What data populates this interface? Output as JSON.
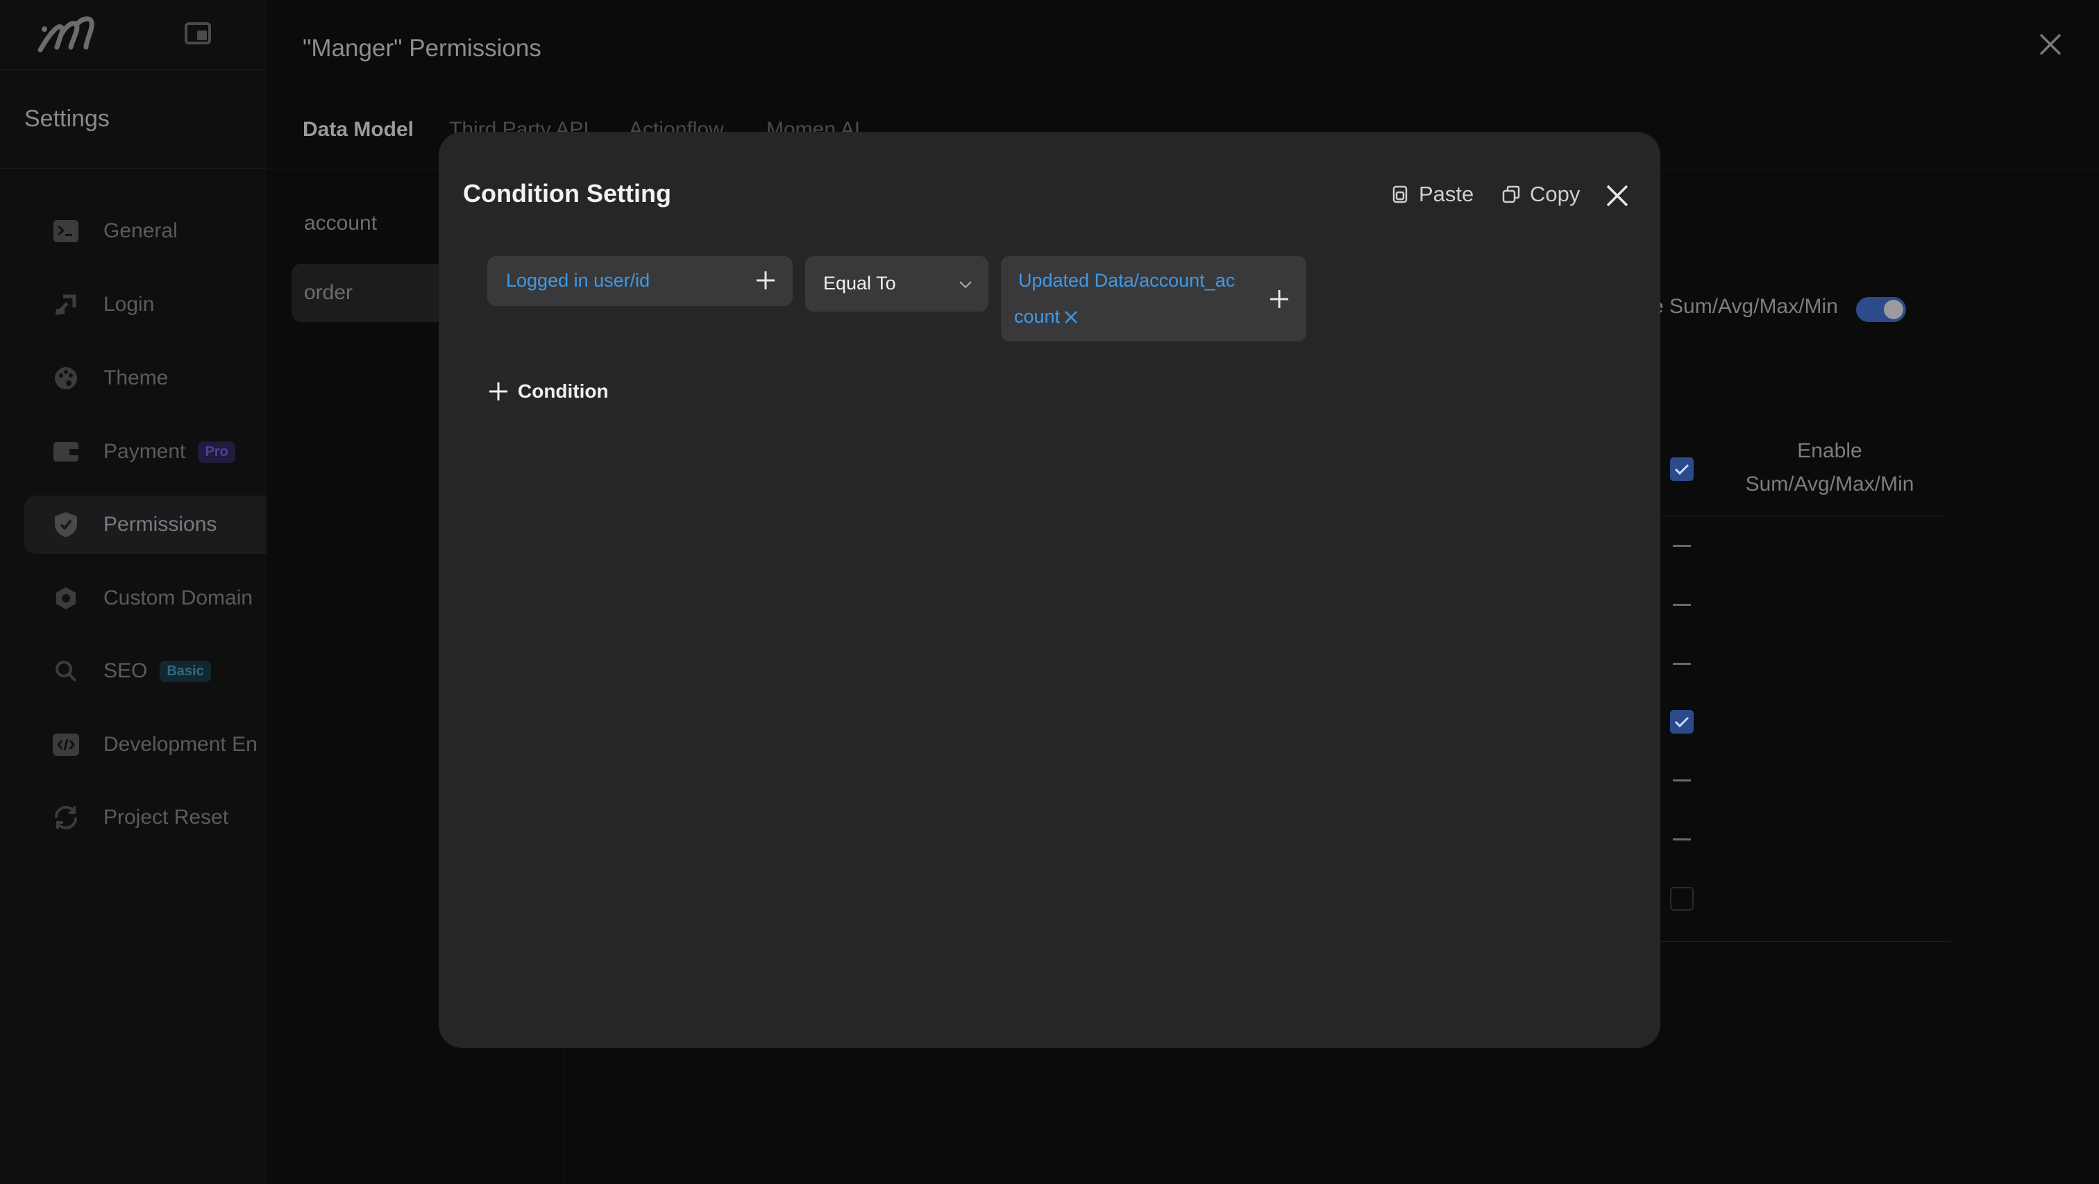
{
  "nav": {
    "title": "Settings",
    "items": [
      {
        "label": "General",
        "icon": "terminal-icon"
      },
      {
        "label": "Login",
        "icon": "login-icon"
      },
      {
        "label": "Theme",
        "icon": "palette-icon"
      },
      {
        "label": "Payment",
        "icon": "wallet-icon",
        "badge": "Pro"
      },
      {
        "label": "Permissions",
        "icon": "shield-check-icon",
        "active": true
      },
      {
        "label": "Custom Domain",
        "icon": "domain-icon"
      },
      {
        "label": "SEO",
        "icon": "search-icon",
        "badge": "Basic"
      },
      {
        "label": "Development En",
        "icon": "code-icon"
      },
      {
        "label": "Project Reset",
        "icon": "reset-icon"
      }
    ]
  },
  "panel": {
    "title": "\"Manger\" Permissions",
    "tabs": [
      "Data Model",
      "Third Party API",
      "Actionflow",
      "Momen AI"
    ],
    "tables": [
      "account",
      "order"
    ],
    "sum_label": "e Sum/Avg/Max/Min",
    "column_header": "Enable Sum/Avg/Max/Min"
  },
  "modal": {
    "title": "Condition Setting",
    "paste_label": "Paste",
    "copy_label": "Copy",
    "condition": {
      "left_value": "Logged in user/id",
      "operator": "Equal To",
      "right_value_line1": "Updated Data/account_ac",
      "right_value_line2": "count"
    },
    "add_condition_label": "Condition"
  },
  "colors": {
    "accent_blue": "#3d9ae8",
    "modal_bg": "#262627",
    "page_bg": "#0d0d0e"
  }
}
